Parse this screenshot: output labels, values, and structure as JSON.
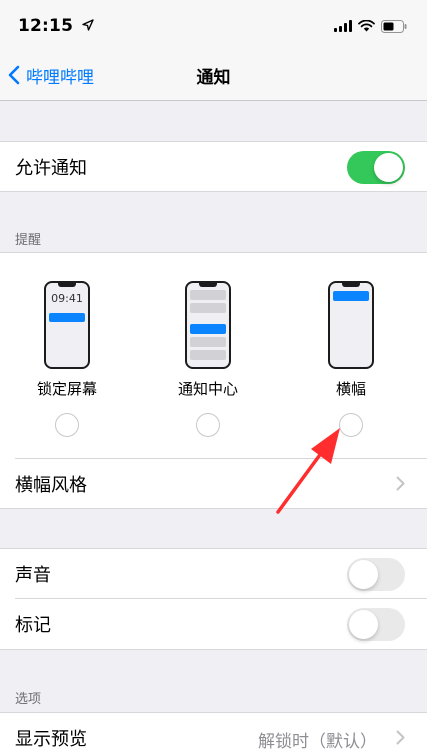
{
  "status_bar": {
    "time": "12:15"
  },
  "nav": {
    "back_label": "哔哩哔哩",
    "title": "通知"
  },
  "allow_notifications": {
    "label": "允许通知",
    "enabled": true
  },
  "alerts": {
    "header": "提醒",
    "options": [
      {
        "label": "锁定屏幕",
        "preview_time": "09:41"
      },
      {
        "label": "通知中心"
      },
      {
        "label": "横幅"
      }
    ],
    "banner_style_label": "横幅风格"
  },
  "sound": {
    "label": "声音",
    "enabled": false
  },
  "badges": {
    "label": "标记",
    "enabled": false
  },
  "options_section": {
    "header": "选项",
    "show_previews": {
      "label": "显示预览",
      "value": "解锁时（默认）"
    }
  },
  "colors": {
    "accent": "#007aff",
    "toggle_on": "#34c759",
    "annotation_arrow": "#ff2d2d"
  }
}
